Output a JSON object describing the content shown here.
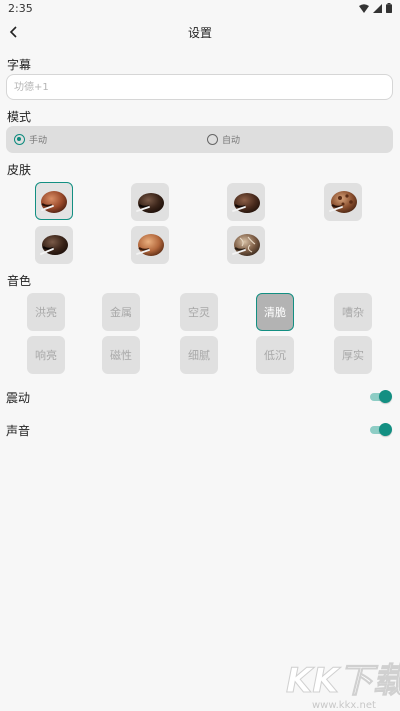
{
  "status_bar": {
    "time": "2:35"
  },
  "header": {
    "title": "设置"
  },
  "subtitle": {
    "label": "字幕",
    "placeholder": "功德+1",
    "value": ""
  },
  "mode": {
    "label": "模式",
    "options": [
      "手动",
      "自动"
    ],
    "selected": "手动"
  },
  "skin": {
    "label": "皮肤",
    "selected_index": 0
  },
  "tone": {
    "label": "音色",
    "row1": [
      "洪亮",
      "金属",
      "空灵",
      "清脆",
      "嘈杂"
    ],
    "row2": [
      "响亮",
      "磁性",
      "细腻",
      "低沉",
      "厚实"
    ],
    "selected": "清脆"
  },
  "vibration": {
    "label": "震动",
    "enabled": true
  },
  "sound": {
    "label": "声音",
    "enabled": true
  },
  "watermark": {
    "brand": "KK下载",
    "site": "www.kkx.net"
  },
  "colors": {
    "accent": "#138f82",
    "background": "#f7f7f7",
    "tile": "#e0e0e0"
  }
}
